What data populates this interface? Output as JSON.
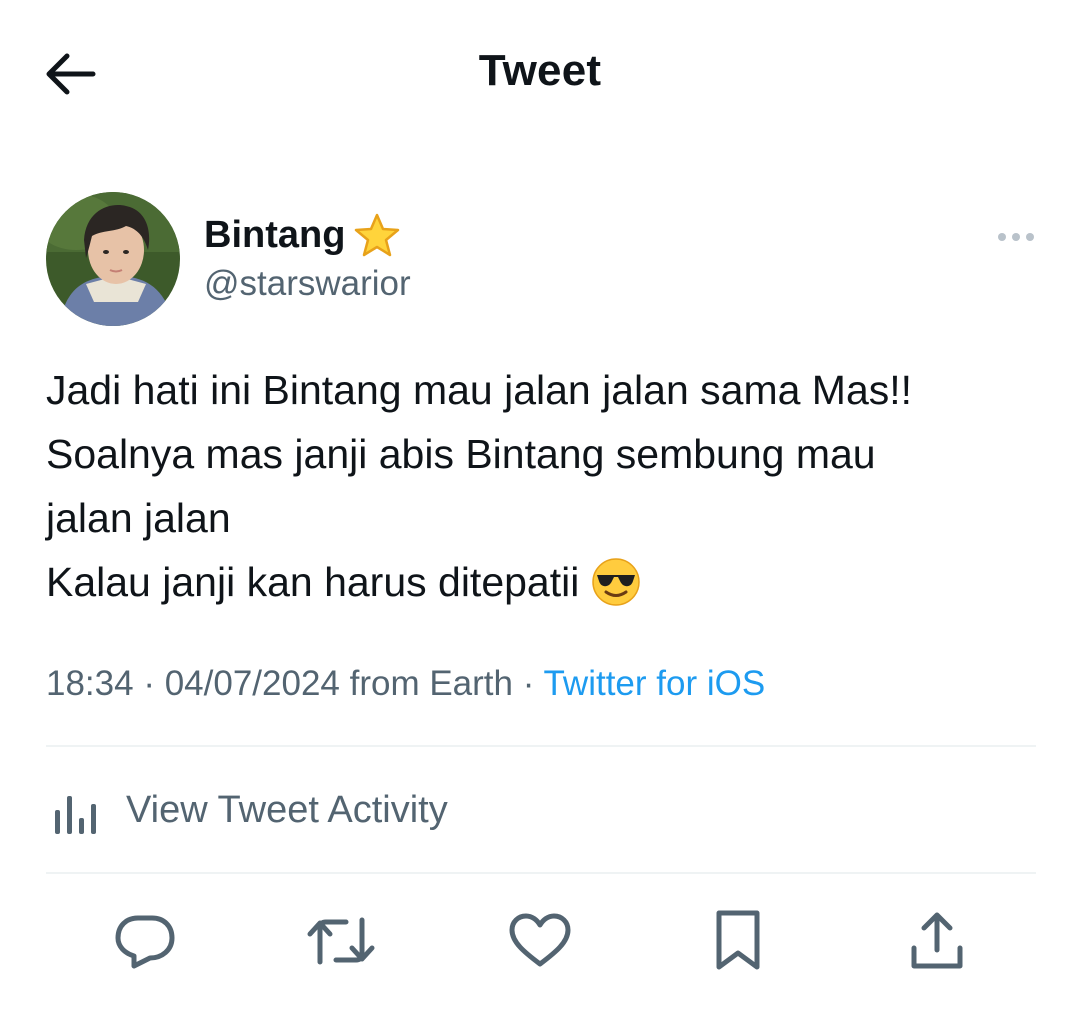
{
  "header": {
    "title": "Tweet",
    "back_icon": "arrow-left-icon"
  },
  "author": {
    "name": "Bintang",
    "badge_icon": "star-emoji-icon",
    "handle": "@starswarior"
  },
  "tweet": {
    "lines": [
      "Jadi hati ini Bintang mau jalan jalan sama Mas!!",
      "Soalnya mas janji abis Bintang sembung mau",
      "jalan jalan",
      "Kalau janji kan harus ditepatii"
    ],
    "trailing_emoji": "smiling-face-with-sunglasses-icon"
  },
  "meta": {
    "time": "18:34",
    "separator": " · ",
    "date": "04/07/2024",
    "location": " from Earth",
    "source": "Twitter for iOS"
  },
  "activity": {
    "label": "View Tweet Activity",
    "icon": "bar-chart-icon"
  },
  "actions": [
    "reply-icon",
    "retweet-icon",
    "like-icon",
    "bookmark-icon",
    "share-icon"
  ],
  "colors": {
    "link": "#1d9bf0",
    "secondary_text": "#536471",
    "text": "#0f1419",
    "divider": "#eff3f4"
  }
}
